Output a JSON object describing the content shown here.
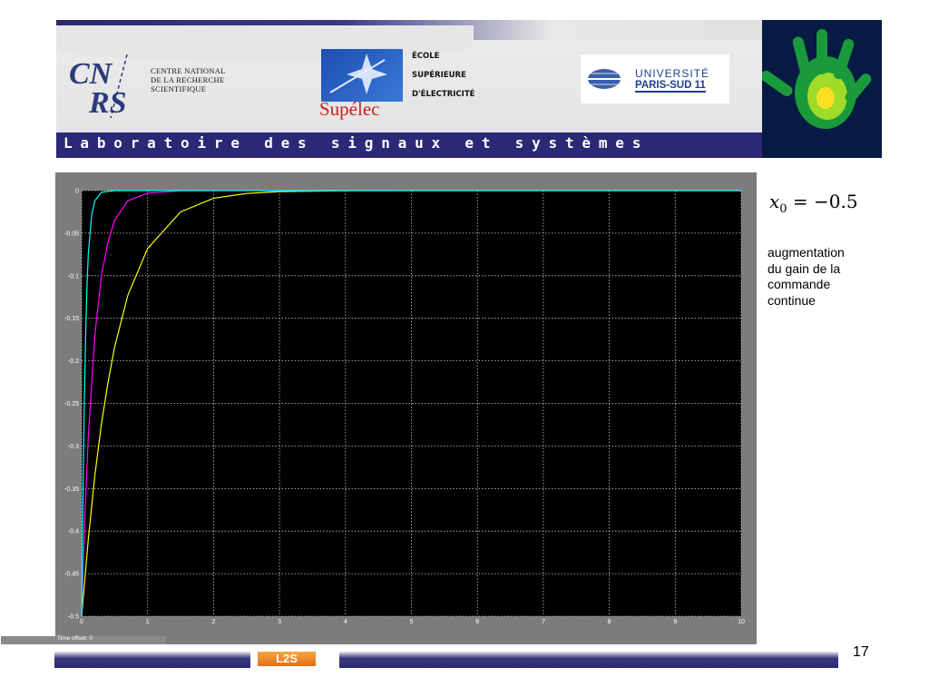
{
  "header": {
    "cnrs_logo_text": "CNRS",
    "cnrs_lines": [
      "CENTRE NATIONAL",
      "DE LA RECHERCHE",
      "SCIENTIFIQUE"
    ],
    "supelec_lines": [
      "ÉCOLE",
      "SUPÉRIEURE",
      "D'ÉLECTRICITÉ"
    ],
    "supelec_word": "Supélec",
    "university_line1": "UNIVERSITÉ",
    "university_line2": "PARIS-SUD 11",
    "lab_title": "Laboratoire des signaux et systèmes"
  },
  "side": {
    "formula_var": "x",
    "formula_sub": "0",
    "formula_rest": " = −0.5",
    "note_lines": [
      "augmentation",
      "du gain de la",
      "commande",
      "continue"
    ]
  },
  "footer": {
    "logo_text": "L2S",
    "page_number": "17"
  },
  "scope": {
    "time_offset_label": "Time offset:  0",
    "colors": {
      "background": "#000000",
      "frame": "#7c7c7c",
      "grid": "#c8c8c8",
      "axis_text": "#ffffff"
    }
  },
  "chart_data": {
    "type": "line",
    "title": "",
    "xlabel": "",
    "ylabel": "",
    "xlim": [
      0,
      10
    ],
    "ylim": [
      -0.5,
      0
    ],
    "x_ticks": [
      0,
      1,
      2,
      3,
      4,
      5,
      6,
      7,
      8,
      9,
      10
    ],
    "y_ticks": [
      0,
      -0.05,
      -0.1,
      -0.15,
      -0.2,
      -0.25,
      -0.3,
      -0.35,
      -0.4,
      -0.45,
      -0.5
    ],
    "x_tick_labels": [
      "0",
      "1",
      "2",
      "3",
      "4",
      "5",
      "6",
      "7",
      "8",
      "9",
      "10"
    ],
    "y_tick_labels": [
      "0",
      "-0.05",
      "-0.1",
      "-0.15",
      "-0.2",
      "-0.25",
      "-0.3",
      "-0.35",
      "-0.4",
      "-0.45",
      "-0.5"
    ],
    "grid": true,
    "series": [
      {
        "color": "#ffff00",
        "x": [
          0,
          0.1,
          0.2,
          0.3,
          0.4,
          0.5,
          0.7,
          1.0,
          1.5,
          2.0,
          2.5,
          3.0,
          4.0,
          5.0,
          6.0,
          7.0,
          8.0,
          10.0
        ],
        "y": [
          -0.5,
          -0.41,
          -0.335,
          -0.274,
          -0.225,
          -0.184,
          -0.123,
          -0.068,
          -0.025,
          -0.009,
          -0.0034,
          -0.0012,
          -0.0002,
          0,
          0,
          0,
          0,
          0
        ]
      },
      {
        "color": "#ff00ff",
        "x": [
          0,
          0.05,
          0.1,
          0.2,
          0.3,
          0.4,
          0.5,
          0.7,
          1.0,
          1.5,
          2.0,
          2.5,
          3.0,
          5.0,
          10.0
        ],
        "y": [
          -0.5,
          -0.38,
          -0.29,
          -0.17,
          -0.1,
          -0.06,
          -0.035,
          -0.012,
          -0.003,
          -0.0003,
          0,
          0,
          0,
          0,
          0
        ]
      },
      {
        "color": "#00ffff",
        "x": [
          0,
          0.02,
          0.04,
          0.06,
          0.08,
          0.1,
          0.15,
          0.2,
          0.3,
          0.5,
          1.0,
          10.0
        ],
        "y": [
          -0.5,
          -0.36,
          -0.25,
          -0.17,
          -0.115,
          -0.075,
          -0.03,
          -0.012,
          -0.002,
          0,
          0,
          0
        ]
      }
    ]
  }
}
